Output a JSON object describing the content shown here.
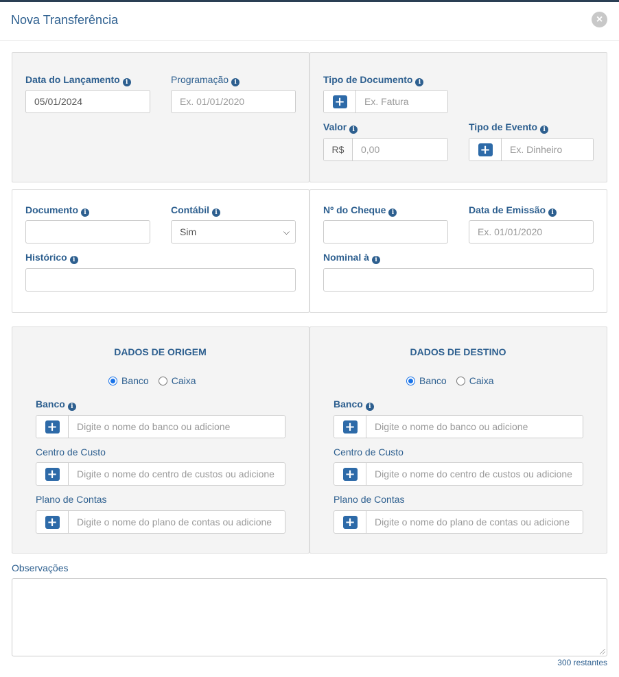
{
  "modal": {
    "title": "Nova Transferência",
    "close_icon": "close-circle-icon"
  },
  "colors": {
    "accent": "#2d5f8f",
    "button": "#2d6aa8",
    "panel_gray": "#f4f4f4"
  },
  "top": {
    "data_lancamento": {
      "label": "Data do Lançamento",
      "value": "05/01/2024"
    },
    "programacao": {
      "label": "Programação",
      "placeholder": "Ex. 01/01/2020"
    },
    "tipo_documento": {
      "label": "Tipo de Documento",
      "placeholder": "Ex. Fatura"
    },
    "valor": {
      "label": "Valor",
      "prefix": "R$",
      "placeholder": "0,00"
    },
    "tipo_evento": {
      "label": "Tipo de Evento",
      "placeholder": "Ex. Dinheiro"
    }
  },
  "middle": {
    "documento": {
      "label": "Documento",
      "value": ""
    },
    "contabil": {
      "label": "Contábil",
      "selected": "Sim"
    },
    "historico": {
      "label": "Histórico",
      "value": ""
    },
    "cheque": {
      "label": "Nº do Cheque",
      "value": ""
    },
    "data_emissao": {
      "label": "Data de Emissão",
      "placeholder": "Ex. 01/01/2020"
    },
    "nominal": {
      "label": "Nominal à",
      "value": ""
    }
  },
  "origem": {
    "title": "DADOS DE ORIGEM",
    "radio_banco": "Banco",
    "radio_caixa": "Caixa",
    "selected": "Banco",
    "banco_label": "Banco",
    "banco_placeholder": "Digite o nome do banco ou adicione",
    "centro_label": "Centro de Custo",
    "centro_placeholder": "Digite o nome do centro de custos ou adicione",
    "plano_label": "Plano de Contas",
    "plano_placeholder": "Digite o nome do plano de contas ou adicione"
  },
  "destino": {
    "title": "DADOS DE DESTINO",
    "radio_banco": "Banco",
    "radio_caixa": "Caixa",
    "selected": "Banco",
    "banco_label": "Banco",
    "banco_placeholder": "Digite o nome do banco ou adicione",
    "centro_label": "Centro de Custo",
    "centro_placeholder": "Digite o nome do centro de custos ou adicione",
    "plano_label": "Plano de Contas",
    "plano_placeholder": "Digite o nome do plano de contas ou adicione"
  },
  "observacoes": {
    "label": "Observações",
    "value": "",
    "counter": "300 restantes"
  }
}
